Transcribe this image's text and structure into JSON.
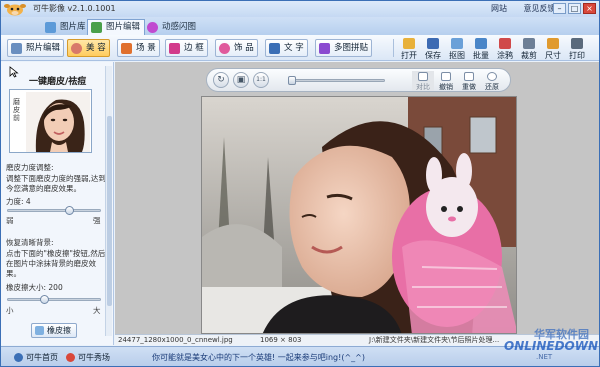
{
  "window": {
    "title": "可牛影像 v2.1.0.1001",
    "links": [
      "网站",
      "意见反馈"
    ],
    "controls": {
      "min": "–",
      "max": "□",
      "close": "×"
    }
  },
  "tabs": [
    {
      "label": "图片库"
    },
    {
      "label": "图片编辑"
    },
    {
      "label": "动感闪图"
    }
  ],
  "toolbar": {
    "left_buttons": [
      {
        "label": "照片编辑"
      },
      {
        "label": "美 容"
      },
      {
        "label": "场 景"
      },
      {
        "label": "边 框"
      },
      {
        "label": "饰 品"
      },
      {
        "label": "文 字"
      },
      {
        "label": "多图拼贴"
      }
    ],
    "right_tools": [
      {
        "label": "打开"
      },
      {
        "label": "保存"
      },
      {
        "label": "抠图"
      },
      {
        "label": "批量"
      },
      {
        "label": "涂鸦"
      },
      {
        "label": "裁剪"
      },
      {
        "label": "尺寸"
      },
      {
        "label": "打印"
      }
    ]
  },
  "left_panel": {
    "title": "一键磨皮/祛痘",
    "thumb_tag": "磨皮前",
    "strength_title": "磨皮力度调整:",
    "strength_desc": "调整下面磨皮力度的强弱,达到今您满意的磨皮效果。",
    "strength_label": "力度: 4",
    "strength_value": 4,
    "strength_min_label": "弱",
    "strength_max_label": "强",
    "restore_title": "恢复清晰背景:",
    "restore_desc": "点击下面的\"橡皮擦\"按钮,然后在图片中涂抹背景的磨皮效果。",
    "eraser_size_label": "橡皮擦大小: 200",
    "eraser_size_value": 200,
    "eraser_min_label": "小",
    "eraser_max_label": "大",
    "eraser_button": "橡皮擦"
  },
  "canvas": {
    "mini_buttons": [
      {
        "label": "对比"
      },
      {
        "label": "撤销"
      },
      {
        "label": "重做"
      },
      {
        "label": "还原"
      }
    ],
    "ctrl_glyphs": {
      "rotate": "↻",
      "fit": "▣",
      "actual": "1:1"
    }
  },
  "infobar": {
    "filename": "24477_1280x1000_0_cnnewl.jpg",
    "dimensions": "1069 × 803",
    "path": "J:\\新建文件夹\\新建文件夹\\节后照片处理..."
  },
  "statusbar": {
    "home": "可牛首页",
    "show": "可牛秀场",
    "marquee": "你可能就是美女心中的下一个英雄! 一起来参与吧ing!(^_^)"
  },
  "watermark": {
    "cn": "华军软件园",
    "en": "ONLINEDOWN",
    "net": ".NET"
  },
  "colors": {
    "accent": "#3b6fb6",
    "active_btn": "#ffcc5e",
    "close_btn": "#d9483b"
  }
}
